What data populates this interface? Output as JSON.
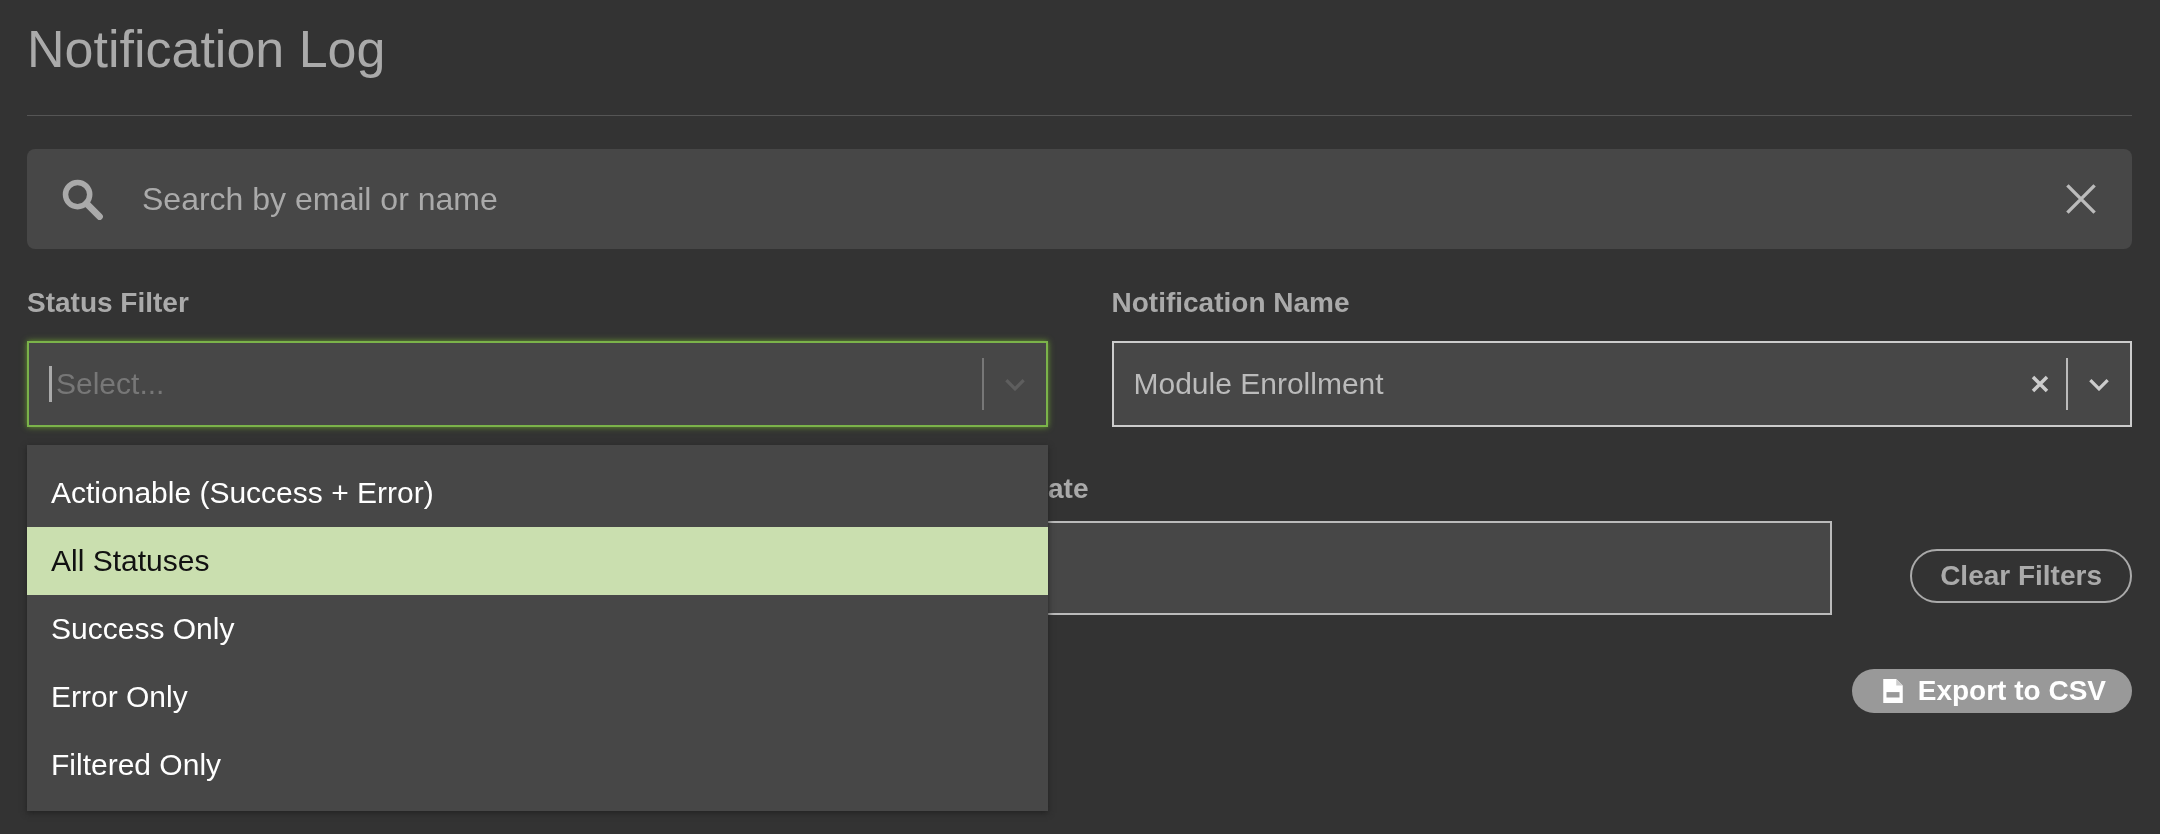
{
  "title": "Notification Log",
  "search": {
    "placeholder": "Search by email or name"
  },
  "status_filter": {
    "label": "Status Filter",
    "placeholder": "Select...",
    "focused": true,
    "options": [
      {
        "label": "Actionable (Success + Error)",
        "selected": false
      },
      {
        "label": "All Statuses",
        "selected": true
      },
      {
        "label": "Success Only",
        "selected": false
      },
      {
        "label": "Error Only",
        "selected": false
      },
      {
        "label": "Filtered Only",
        "selected": false
      }
    ]
  },
  "notification_name": {
    "label": "Notification Name",
    "value": "Module Enrollment"
  },
  "date": {
    "label": "ate"
  },
  "buttons": {
    "clear": "Clear Filters",
    "export": "Export to CSV"
  }
}
